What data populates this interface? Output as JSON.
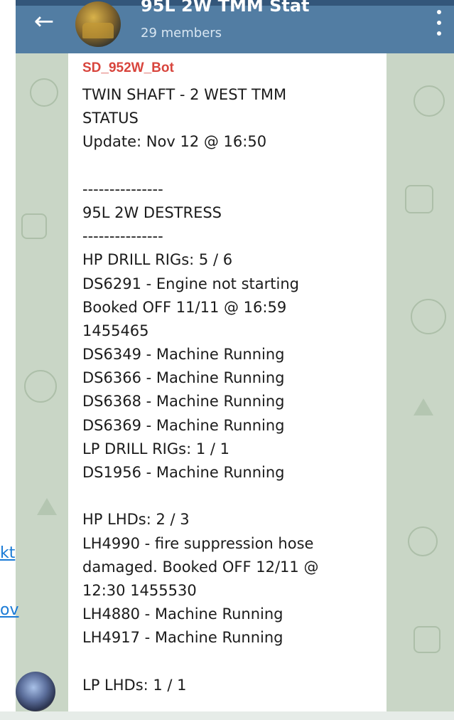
{
  "header": {
    "back_icon": "arrow-left-icon",
    "title": "95L 2W TMM Stat",
    "members": "29 members",
    "menu_icon": "more-vert-icon",
    "color": "#527da3"
  },
  "left_fragments": [
    "kt",
    "ov"
  ],
  "message": {
    "sender": "SD_952W_Bot",
    "sender_color": "#d8453d",
    "lines": [
      "TWIN SHAFT - 2 WEST TMM",
      "STATUS",
      "Update: Nov 12  @ 16:50",
      "",
      "---------------",
      "95L 2W DESTRESS",
      "---------------",
      "HP DRILL RIGs: 5 / 6",
      "DS6291 - Engine not starting",
      "Booked OFF 11/11 @ 16:59",
      "1455465",
      "DS6349 - Machine Running",
      "DS6366 - Machine Running",
      "DS6368 - Machine Running",
      "DS6369 - Machine Running",
      "LP DRILL RIGs: 1 / 1",
      "DS1956 - Machine Running",
      "",
      "HP LHDs: 2 / 3",
      "LH4990 - fire suppression hose",
      "damaged. Booked OFF 12/11 @",
      "12:30  1455530",
      "LH4880 - Machine Running",
      "LH4917 - Machine Running",
      "",
      "LP LHDs: 1 / 1"
    ]
  }
}
